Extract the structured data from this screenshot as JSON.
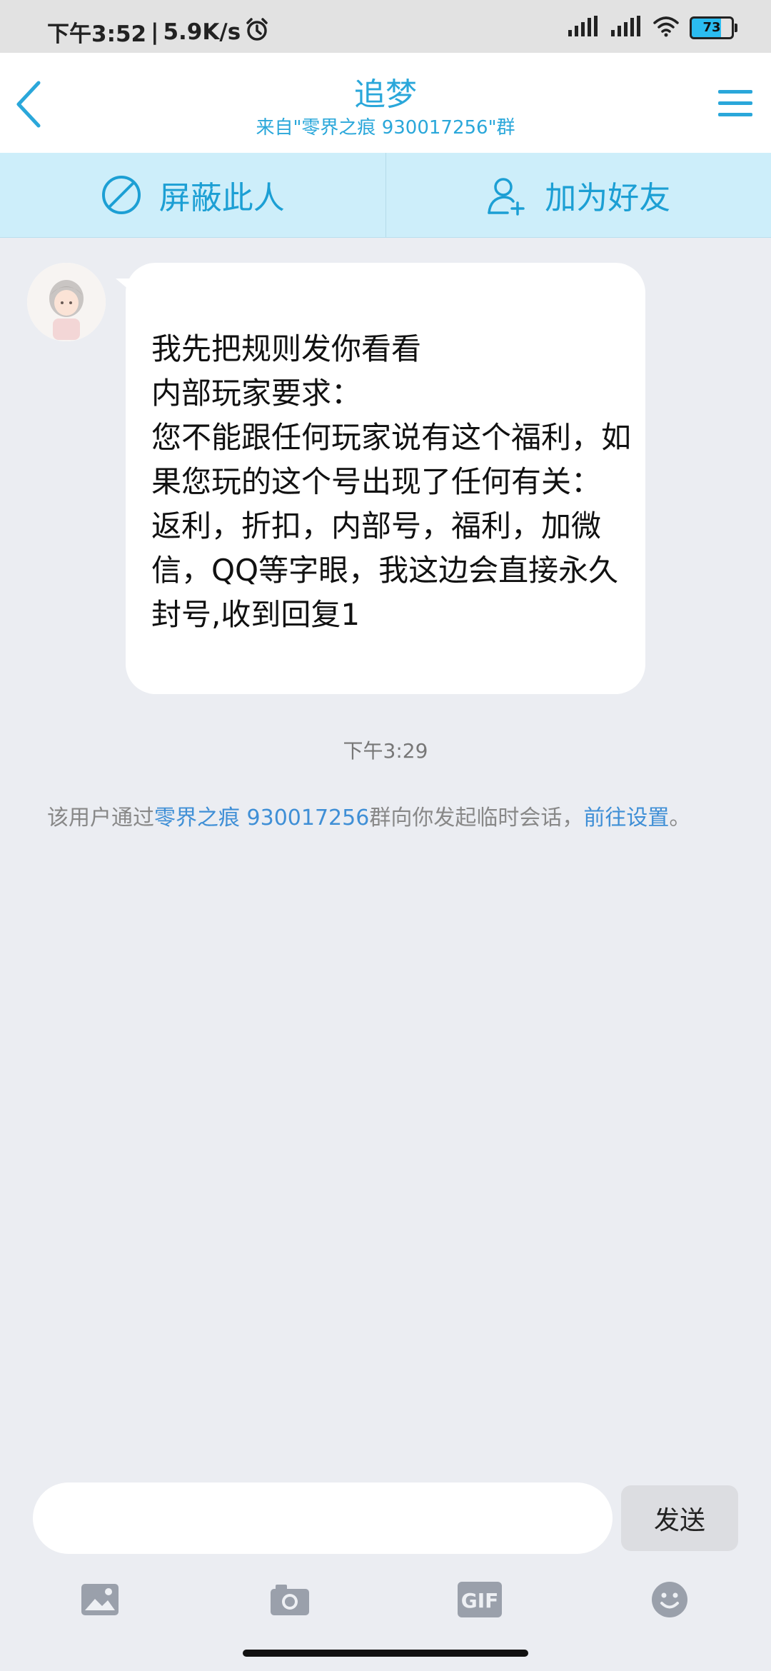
{
  "status_bar": {
    "time": "下午3:52",
    "separator": "|",
    "net_speed": "5.9K/s",
    "battery_level": "73",
    "icons": [
      "alarm-icon",
      "signal-icon",
      "signal-icon",
      "wifi-icon",
      "battery-icon"
    ]
  },
  "header": {
    "title": "追梦",
    "subtitle": "来自\"零界之痕  930017256\"群",
    "back_icon": "back-chevron-icon",
    "menu_icon": "menu-icon",
    "accent_color": "#2aa7da"
  },
  "actions": {
    "block": {
      "label": "屏蔽此人",
      "icon": "block-icon"
    },
    "add_friend": {
      "label": "加为好友",
      "icon": "add-user-icon"
    }
  },
  "message": {
    "text": "我先把规则发你看看\n内部玩家要求：\n您不能跟任何玩家说有这个福利，如果您玩的这个号出现了任何有关：\n返利，折扣，内部号，福利，加微信，QQ等字眼，我这边会直接永久封号,收到回复1",
    "time": "下午3:29"
  },
  "system_note": {
    "prefix": "该用户通过",
    "group_name": "零界之痕  930017256",
    "middle": "群向你发起临时会话，",
    "link": "前往设置",
    "suffix": "。"
  },
  "composer": {
    "placeholder": "",
    "send_label": "发送"
  },
  "toolbar": {
    "items": [
      "image-icon",
      "camera-icon",
      "gif-icon",
      "emoji-icon"
    ],
    "gif_text": "GIF"
  }
}
